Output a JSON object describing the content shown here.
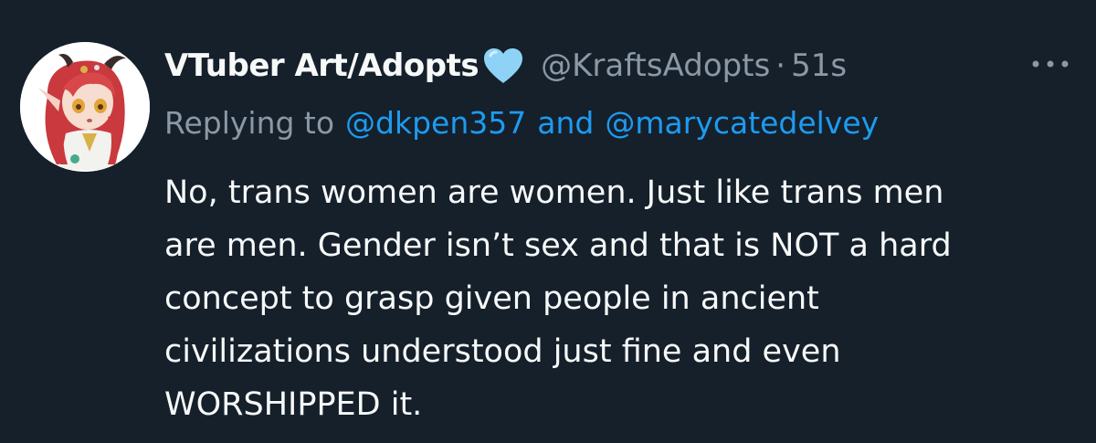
{
  "author": {
    "display_name": "VTuber Art/Adopts",
    "badge_icon": "light-blue-heart-icon",
    "handle": "@KraftsAdopts",
    "separator": "·",
    "time": "51s"
  },
  "reply": {
    "label": "Replying to",
    "mentions": [
      "@dkpen357",
      "@marycatedelvey"
    ],
    "conjunction": "and"
  },
  "tweet_lines": [
    "No, trans women are women. Just like trans men",
    "are men. Gender isn’t sex and that is NOT a hard",
    "concept to grasp given people in ancient",
    "civilizations understood just fine and even",
    "WORSHIPPED it."
  ],
  "colors": {
    "background": "#15202b",
    "text": "#f7f9f9",
    "secondary": "#8b98a5",
    "link": "#1d9bf0",
    "heart": "#8ed3f5"
  },
  "more_icon": "more-horizontal-icon"
}
